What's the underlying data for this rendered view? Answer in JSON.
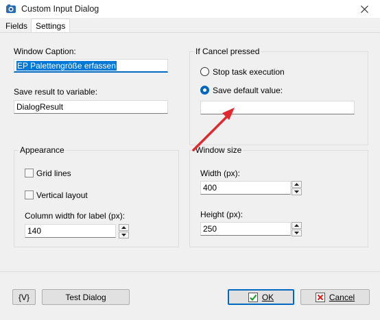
{
  "window": {
    "title": "Custom Input Dialog"
  },
  "tabs": [
    {
      "label": "Fields"
    },
    {
      "label": "Settings"
    }
  ],
  "settings": {
    "caption_label": "Window Caption:",
    "caption_value": "EP Palettengröße erfassen",
    "result_label": "Save result to variable:",
    "result_value": "DialogResult",
    "cancel_group": {
      "title": "If Cancel pressed",
      "option_stop": "Stop task execution",
      "option_default": "Save default value:",
      "selected": "option_default",
      "default_value": ""
    },
    "appearance": {
      "title": "Appearance",
      "grid_lines": "Grid lines",
      "grid_lines_checked": false,
      "vertical_layout": "Vertical layout",
      "vertical_layout_checked": false,
      "column_width_label": "Column width for label (px):",
      "column_width_value": "140"
    },
    "window_size": {
      "title": "Window size",
      "width_label": "Width (px):",
      "width_value": "400",
      "height_label": "Height (px):",
      "height_value": "250"
    }
  },
  "buttons": {
    "variable": "{V}",
    "test": "Test Dialog",
    "ok": "OK",
    "cancel": "Cancel"
  },
  "colors": {
    "accent": "#0067c0",
    "selection": "#0078d7",
    "annotation_arrow": "#e0282e"
  }
}
